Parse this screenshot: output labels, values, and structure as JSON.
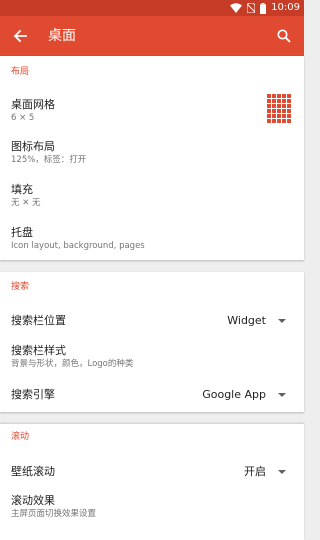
{
  "status_bar": {
    "time": "10:09",
    "bg": "#c63c26"
  },
  "toolbar": {
    "title": "桌面",
    "bg": "#e04a30",
    "back_icon": "arrow-back-icon",
    "search_icon": "search-icon"
  },
  "sections": {
    "layout": {
      "header": "布局",
      "items": [
        {
          "title": "桌面网格",
          "subtitle": "6 × 5"
        },
        {
          "title": "图标布局",
          "subtitle": "125%，标签：打开"
        },
        {
          "title": "填充",
          "subtitle": "无 ✕ 无"
        },
        {
          "title": "托盘",
          "subtitle": "Icon layout, background, pages"
        }
      ]
    },
    "search": {
      "header": "搜索",
      "items": [
        {
          "title": "搜索栏位置",
          "value": "Widget"
        },
        {
          "title": "搜索栏样式",
          "subtitle": "背景与形状，颜色，Logo的种类"
        },
        {
          "title": "搜索引擎",
          "value": "Google App"
        }
      ]
    },
    "scroll": {
      "header": "滚动",
      "items": [
        {
          "title": "壁纸滚动",
          "value": "开启"
        },
        {
          "title": "滚动效果",
          "subtitle": "主屏页面切换效果设置"
        }
      ]
    }
  },
  "accent_color": "#e04a30"
}
